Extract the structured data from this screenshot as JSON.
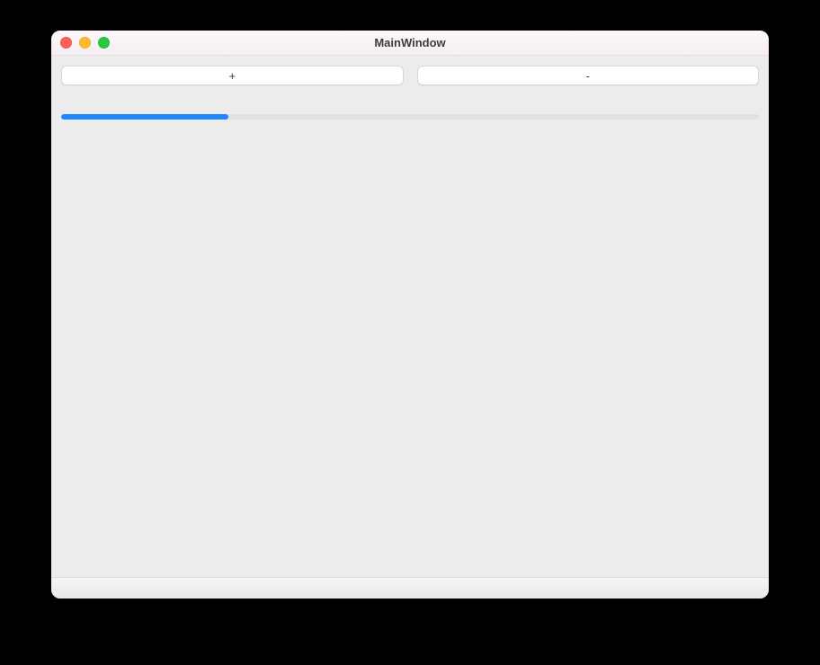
{
  "window": {
    "title": "MainWindow"
  },
  "buttons": {
    "plus_label": "+",
    "minus_label": "-"
  },
  "progress": {
    "value": 24
  }
}
